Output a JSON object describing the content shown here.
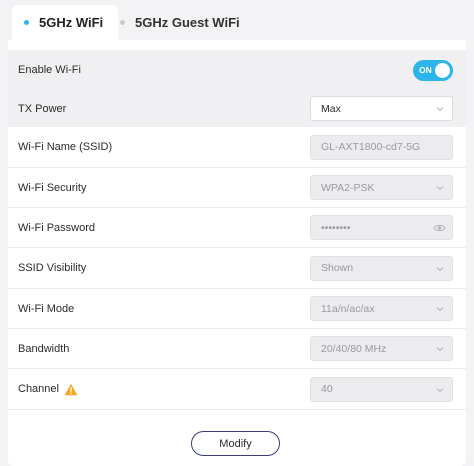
{
  "tabs": [
    {
      "label": "5GHz WiFi",
      "active": true
    },
    {
      "label": "5GHz Guest WiFi",
      "active": false
    }
  ],
  "settings": {
    "enable_wifi": {
      "label": "Enable Wi-Fi",
      "state_label": "ON"
    },
    "tx_power": {
      "label": "TX Power",
      "value": "Max"
    },
    "ssid": {
      "label": "Wi-Fi Name (SSID)",
      "value": "GL-AXT1800-cd7-5G"
    },
    "security": {
      "label": "Wi-Fi Security",
      "value": "WPA2-PSK"
    },
    "password": {
      "label": "Wi-Fi Password",
      "value": "••••••••"
    },
    "ssid_visibility": {
      "label": "SSID Visibility",
      "value": "Shown"
    },
    "mode": {
      "label": "Wi-Fi Mode",
      "value": "11a/n/ac/ax"
    },
    "bandwidth": {
      "label": "Bandwidth",
      "value": "20/40/80 MHz"
    },
    "channel": {
      "label": "Channel",
      "value": "40"
    }
  },
  "actions": {
    "modify_label": "Modify"
  },
  "colors": {
    "accent": "#2bb5ea",
    "button_border": "#3a3d7a",
    "warning": "#f5a623"
  },
  "icons": {
    "warning": "warning-icon",
    "eye": "eye-icon",
    "chevron": "chevron-down-icon"
  }
}
